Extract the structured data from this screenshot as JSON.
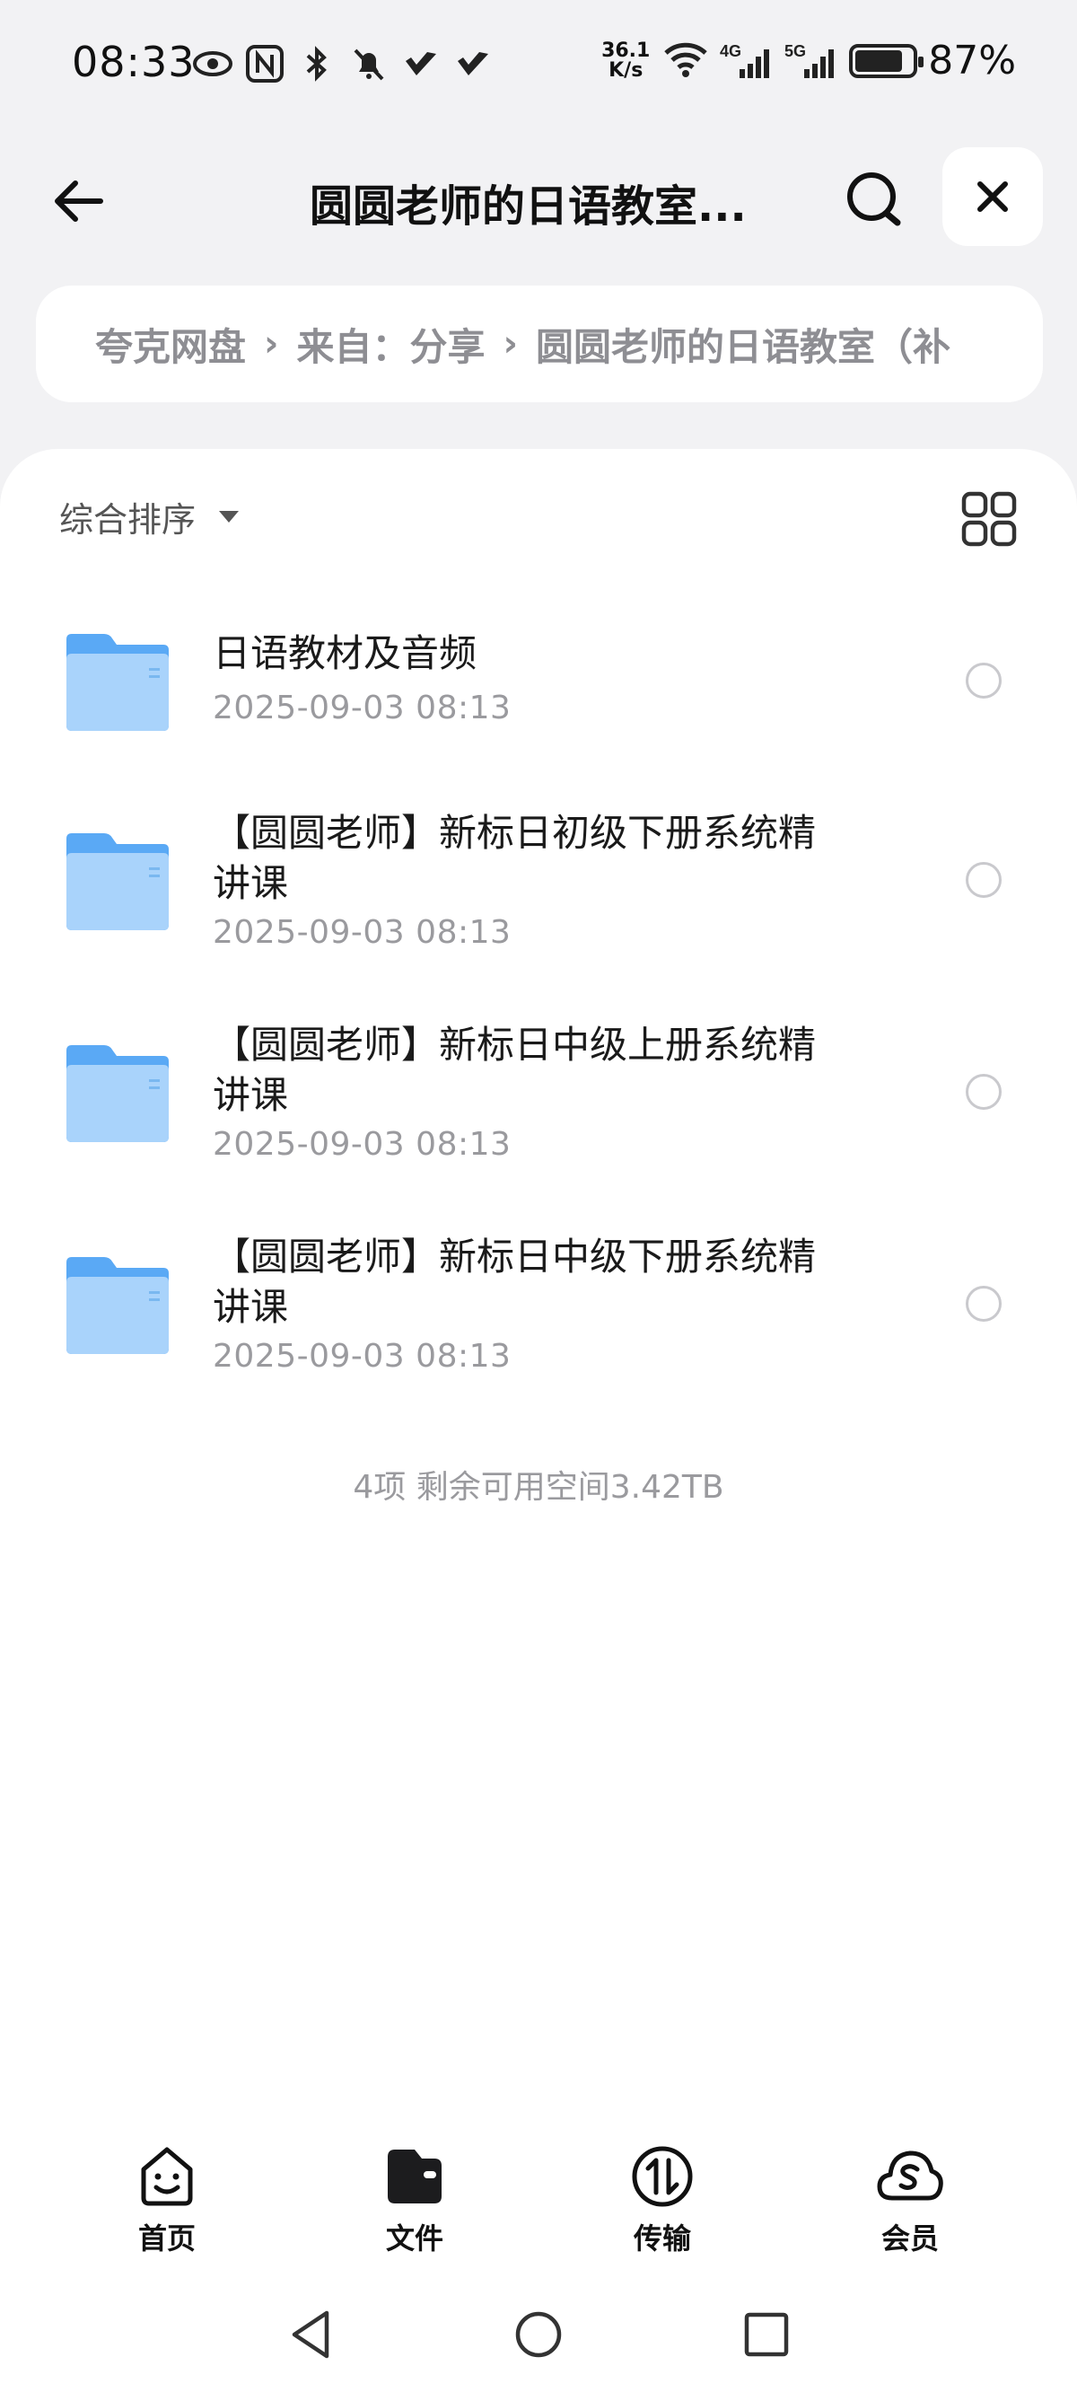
{
  "status_bar": {
    "time": "08:33",
    "speed_value": "36.1",
    "speed_unit": "K/s",
    "net_4g": "4G",
    "net_5g": "5G",
    "battery": "87%"
  },
  "header": {
    "title": "圆圆老师的日语教室..."
  },
  "breadcrumb": {
    "items": [
      "夸克网盘",
      "来自：分享",
      "圆圆老师的日语教室（补"
    ],
    "separator": "›"
  },
  "toolbar": {
    "sort_label": "综合排序"
  },
  "files": [
    {
      "name": "日语教材及音频",
      "date": "2025-09-03 08:13"
    },
    {
      "name": "【圆圆老师】新标日初级下册系统精讲课",
      "date": "2025-09-03 08:13"
    },
    {
      "name": "【圆圆老师】新标日中级上册系统精讲课",
      "date": "2025-09-03 08:13"
    },
    {
      "name": "【圆圆老师】新标日中级下册系统精讲课",
      "date": "2025-09-03 08:13"
    }
  ],
  "summary": "4项 剩余可用空间3.42TB",
  "bottom_nav": [
    {
      "label": "首页",
      "icon": "home-face-icon"
    },
    {
      "label": "文件",
      "icon": "folder-wallet-icon"
    },
    {
      "label": "传输",
      "icon": "transfer-icon"
    },
    {
      "label": "会员",
      "icon": "cloud-s-icon"
    }
  ],
  "colors": {
    "folder_blue": "#5aa9f5",
    "folder_light": "#a9d3fb",
    "background": "#f2f2f4",
    "text_secondary": "#9a9a9e"
  }
}
